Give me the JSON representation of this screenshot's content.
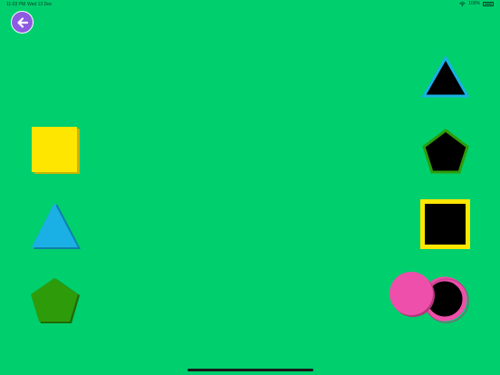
{
  "status_bar": {
    "time": "11:03 PM",
    "date": "Wed 13 Dec",
    "battery_text": "100%"
  },
  "navigation": {
    "back_icon": "arrow-left-icon"
  },
  "colors": {
    "background": "#00CF6E",
    "back_button": "#8E5BE0",
    "yellow": "#FFE600",
    "blue": "#1AB0E5",
    "green": "#2E9C0A",
    "pink": "#EE4FAA",
    "hole": "#000000"
  },
  "game": {
    "draggable_shapes": [
      {
        "shape": "square",
        "color": "yellow"
      },
      {
        "shape": "triangle",
        "color": "blue"
      },
      {
        "shape": "pentagon",
        "color": "green"
      },
      {
        "shape": "circle",
        "color": "pink"
      }
    ],
    "target_slots": [
      {
        "shape": "triangle",
        "outline_color": "blue"
      },
      {
        "shape": "pentagon",
        "outline_color": "green"
      },
      {
        "shape": "square",
        "outline_color": "yellow"
      },
      {
        "shape": "circle",
        "outline_color": "pink"
      }
    ]
  }
}
